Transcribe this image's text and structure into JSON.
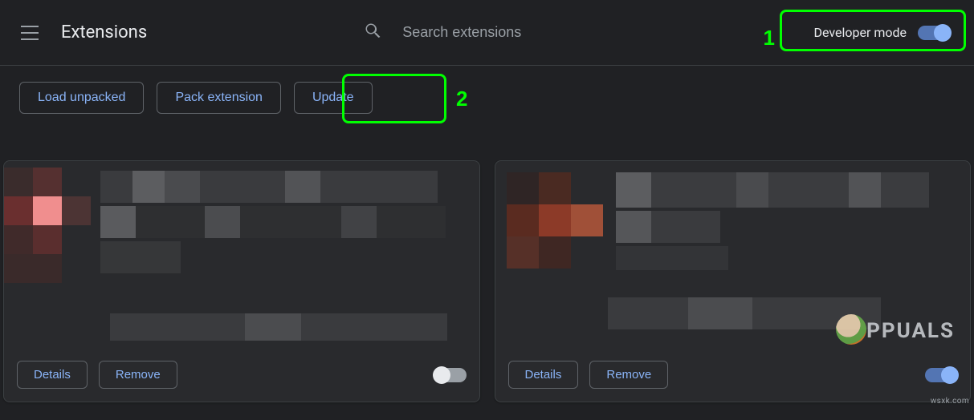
{
  "header": {
    "title": "Extensions",
    "search_placeholder": "Search extensions",
    "dev_mode_label": "Developer mode"
  },
  "toolbar": {
    "load_unpacked": "Load unpacked",
    "pack_extension": "Pack extension",
    "update": "Update"
  },
  "annotations": {
    "dev_mode_marker": "1",
    "update_marker": "2"
  },
  "cards": [
    {
      "details": "Details",
      "remove": "Remove",
      "enabled": false
    },
    {
      "details": "Details",
      "remove": "Remove",
      "enabled": true
    }
  ],
  "branding": {
    "appuals": "PPUALS",
    "watermark": "wsxk.com"
  }
}
